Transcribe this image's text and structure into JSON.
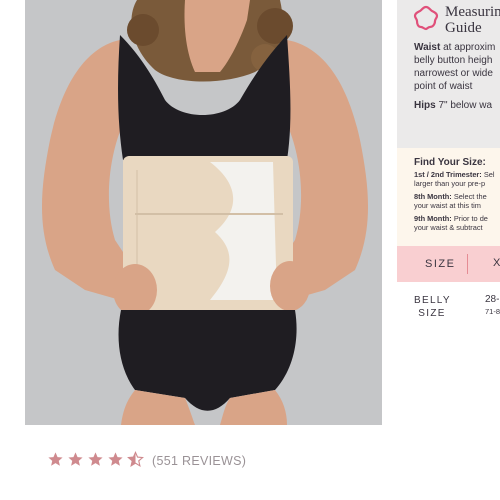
{
  "product_image": {
    "alt": "Model wearing postpartum belly wrap",
    "background": "#c5c6c8"
  },
  "guide": {
    "title_line1": "Measurin",
    "title_line2": "Guide",
    "icon": "flower-icon",
    "waist_label": "Waist",
    "waist_text1": " at approxim",
    "waist_text2": "belly button heigh",
    "waist_text3": "narrowest or wide",
    "waist_text4": "point of waist",
    "hips_label": "Hips",
    "hips_text": " 7\" below wa"
  },
  "find_size": {
    "title": "Find Your Size:",
    "lines": [
      {
        "bold": "1st / 2nd Trimester:",
        "text": " Sel"
      },
      {
        "bold": "",
        "text": "larger than your pre-p"
      },
      {
        "bold": "8th Month:",
        "text": " Select the"
      },
      {
        "bold": "",
        "text": "your waist at this tim"
      },
      {
        "bold": "9th Month:",
        "text": " Prior to de"
      },
      {
        "bold": "",
        "text": "your waist & subtract"
      }
    ]
  },
  "size_table": {
    "header": "SIZE",
    "next": "X",
    "row_label": "BELLY SIZE",
    "row_value_in": "28-",
    "row_value_cm": "71-8"
  },
  "rating": {
    "value": 4.5,
    "max": 5,
    "star_color": "#cf8a8e",
    "reviews_text": "(551 REVIEWS)"
  }
}
